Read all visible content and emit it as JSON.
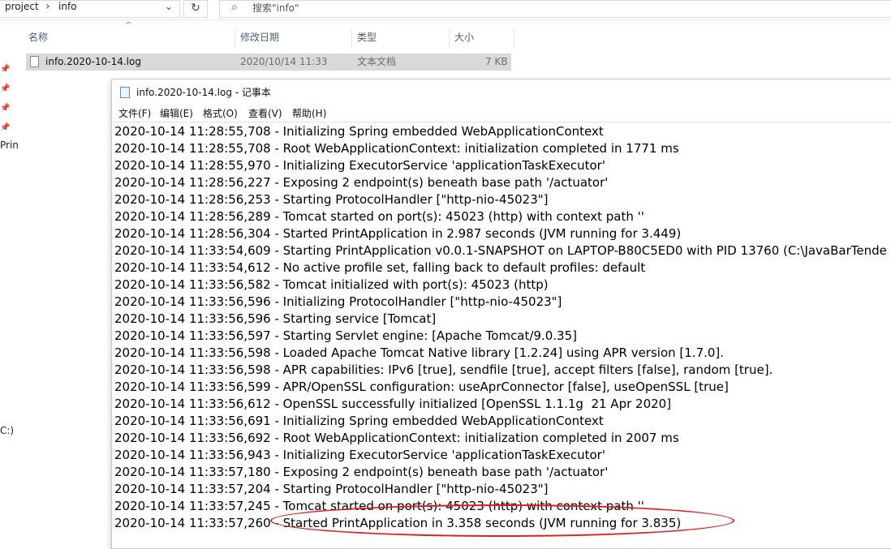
{
  "explorer": {
    "breadcrumb": [
      "project",
      "info"
    ],
    "search_placeholder": "搜索\"info\"",
    "columns": [
      "名称",
      "修改日期",
      "类型",
      "大小"
    ],
    "file": {
      "name": "info.2020-10-14.log",
      "modified": "2020/10/14 11:33",
      "type": "文本文档",
      "size": "7 KB"
    },
    "sidebar_fragments": [
      "Prin",
      "C:)"
    ]
  },
  "notepad": {
    "title": "info.2020-10-14.log - 记事本",
    "menu": [
      "文件(F)",
      "编辑(E)",
      "格式(O)",
      "查看(V)",
      "帮助(H)"
    ],
    "lines": [
      "2020-10-14 11:28:55,708 - Initializing Spring embedded WebApplicationContext",
      "2020-10-14 11:28:55,708 - Root WebApplicationContext: initialization completed in 1771 ms",
      "2020-10-14 11:28:55,970 - Initializing ExecutorService 'applicationTaskExecutor'",
      "2020-10-14 11:28:56,227 - Exposing 2 endpoint(s) beneath base path '/actuator'",
      "2020-10-14 11:28:56,253 - Starting ProtocolHandler [\"http-nio-45023\"]",
      "2020-10-14 11:28:56,289 - Tomcat started on port(s): 45023 (http) with context path ''",
      "2020-10-14 11:28:56,304 - Started PrintApplication in 2.987 seconds (JVM running for 3.449)",
      "2020-10-14 11:33:54,609 - Starting PrintApplication v0.0.1-SNAPSHOT on LAPTOP-B80C5ED0 with PID 13760 (C:\\JavaBarTende",
      "2020-10-14 11:33:54,612 - No active profile set, falling back to default profiles: default",
      "2020-10-14 11:33:56,582 - Tomcat initialized with port(s): 45023 (http)",
      "2020-10-14 11:33:56,596 - Initializing ProtocolHandler [\"http-nio-45023\"]",
      "2020-10-14 11:33:56,596 - Starting service [Tomcat]",
      "2020-10-14 11:33:56,597 - Starting Servlet engine: [Apache Tomcat/9.0.35]",
      "2020-10-14 11:33:56,598 - Loaded Apache Tomcat Native library [1.2.24] using APR version [1.7.0].",
      "2020-10-14 11:33:56,598 - APR capabilities: IPv6 [true], sendfile [true], accept filters [false], random [true].",
      "2020-10-14 11:33:56,599 - APR/OpenSSL configuration: useAprConnector [false], useOpenSSL [true]",
      "2020-10-14 11:33:56,612 - OpenSSL successfully initialized [OpenSSL 1.1.1g  21 Apr 2020]",
      "2020-10-14 11:33:56,691 - Initializing Spring embedded WebApplicationContext",
      "2020-10-14 11:33:56,692 - Root WebApplicationContext: initialization completed in 2007 ms",
      "2020-10-14 11:33:56,943 - Initializing ExecutorService 'applicationTaskExecutor'",
      "2020-10-14 11:33:57,180 - Exposing 2 endpoint(s) beneath base path '/actuator'",
      "2020-10-14 11:33:57,204 - Starting ProtocolHandler [\"http-nio-45023\"]",
      "2020-10-14 11:33:57,245 - Tomcat started on port(s): 45023 (http) with context path ''",
      "2020-10-14 11:33:57,260 - Started PrintApplication in 3.358 seconds (JVM running for 3.835)"
    ],
    "highlight_color": "#e11e1e"
  }
}
